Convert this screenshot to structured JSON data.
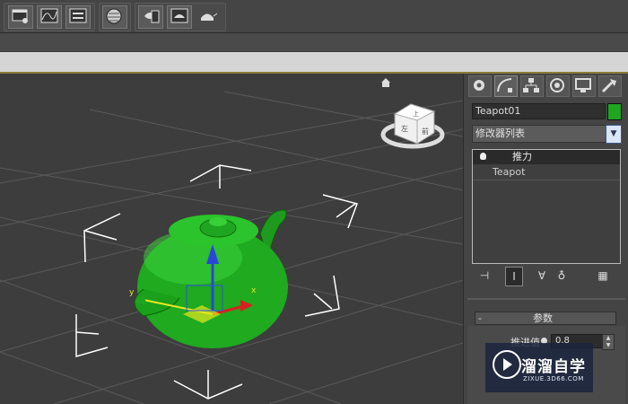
{
  "toolbar": {
    "icons": [
      "scene-explorer-icon",
      "curve-editor-icon",
      "schematic-view-icon",
      "material-editor-icon",
      "render-setup-icon",
      "rendered-frame-icon",
      "quick-render-icon"
    ]
  },
  "viewport": {
    "object_color": "#1faa1f",
    "viewcube_labels": [
      "上",
      "前",
      "左"
    ],
    "gizmo_x_label": "x",
    "gizmo_y_label": "y"
  },
  "command_panel": {
    "tabs": [
      "create-icon",
      "modify-icon",
      "hierarchy-icon",
      "motion-icon",
      "display-icon",
      "utilities-icon"
    ],
    "active_tab": "modify-icon",
    "object_name": "Teapot01",
    "object_color": "#1fa51f",
    "modifier_list_label": "修改器列表",
    "stack": [
      {
        "label": "推力",
        "selected": true
      },
      {
        "label": "Teapot",
        "selected": false
      }
    ],
    "tools": [
      "pin-stack-icon",
      "show-end-result-icon",
      "make-unique-icon",
      "remove-modifier-icon",
      "configure-sets-icon"
    ]
  },
  "parameters": {
    "rollout_toggle": "-",
    "rollout_title": "参数",
    "push_label": "推进值",
    "push_value": "0.8",
    "spinner_up": "▲",
    "spinner_down": "▼"
  },
  "watermark": {
    "title": "溜溜自学",
    "url": "ZIXUE.3D66.COM"
  }
}
